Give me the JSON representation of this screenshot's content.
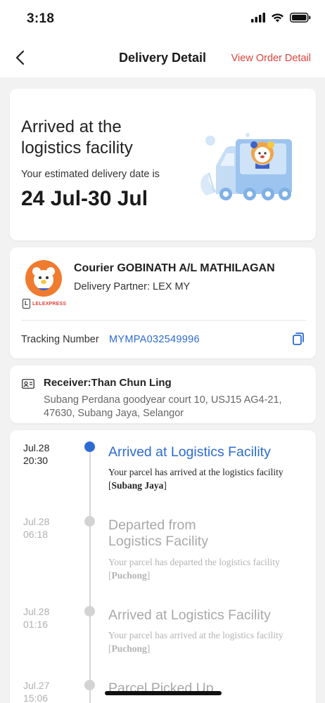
{
  "status_bar": {
    "time": "3:18"
  },
  "nav": {
    "title": "Delivery Detail",
    "view_order_link": "View Order Detail"
  },
  "status_card": {
    "title": "Arrived at the logistics facility",
    "subtitle": "Your estimated delivery date is",
    "date_range": "24 Jul-30 Jul"
  },
  "courier": {
    "name": "Courier GOBINATH A/L MATHILAGAN",
    "partner": "Delivery Partner: LEX MY",
    "logo_text": "LELEXPRESS",
    "tracking_label": "Tracking Number",
    "tracking_number": "MYMPA032549996"
  },
  "receiver": {
    "name": "Receiver:Than Chun Ling",
    "address": "Subang Perdana goodyear court 10, USJ15 AG4-21, 47630, Subang Jaya, Selangor"
  },
  "timeline": [
    {
      "date": "Jul.28",
      "time": "20:30",
      "title": "Arrived at Logistics Facility",
      "description": "Your parcel has arrived at the logistics facility",
      "location": "Subang Jaya",
      "active": true
    },
    {
      "date": "Jul.28",
      "time": "06:18",
      "title": "Departed from Logistics Facility",
      "description": "Your parcel has departed the logistics facility",
      "location": "Puchong",
      "active": false
    },
    {
      "date": "Jul.28",
      "time": "01:16",
      "title": "Arrived at Logistics Facility",
      "description": "Your parcel has arrived at the logistics facility",
      "location": "Puchong",
      "active": false
    },
    {
      "date": "Jul.27",
      "time": "15:06",
      "title": "Parcel Picked Up",
      "description": "",
      "location": "",
      "active": false
    }
  ],
  "colors": {
    "accent_blue": "#2c6bd1",
    "link_red": "#e0433a",
    "inactive_gray": "#a8a8a8"
  }
}
